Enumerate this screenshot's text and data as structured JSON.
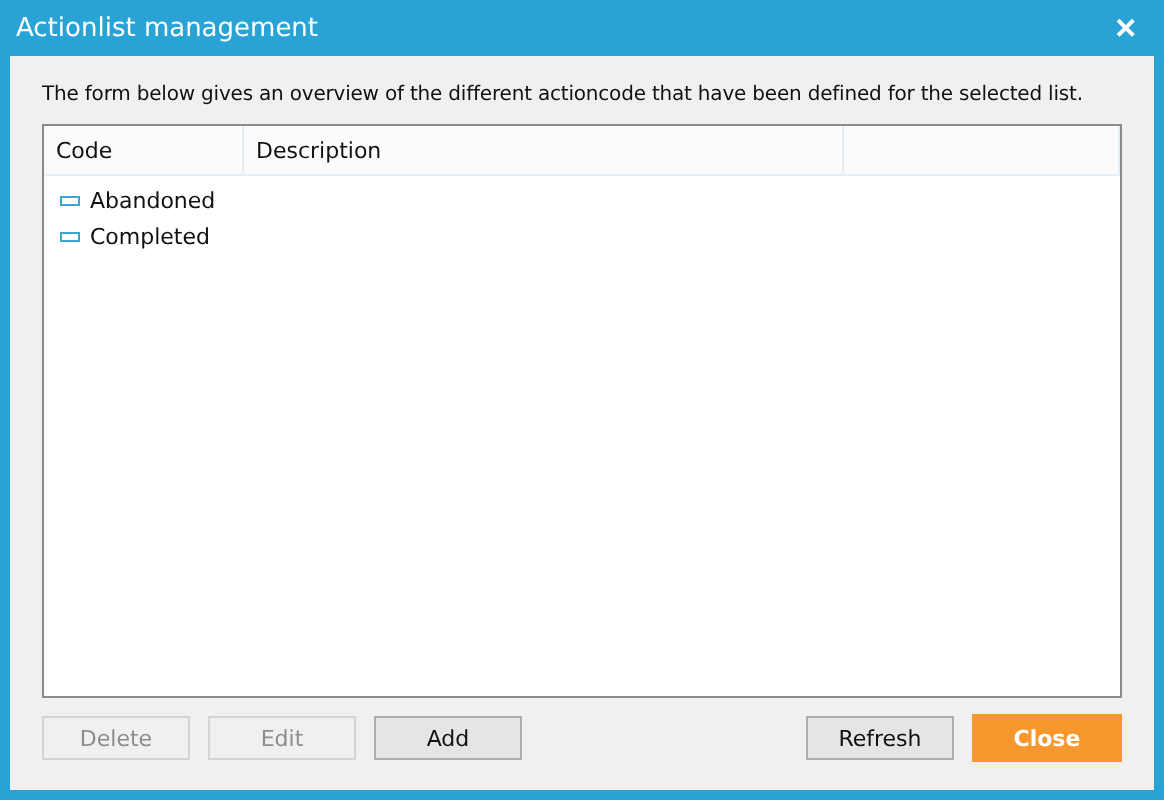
{
  "window": {
    "title": "Actionlist management",
    "close": "✕"
  },
  "intro": "The form below gives an overview of the different actioncode that have been defined for the selected list.",
  "table": {
    "columns": [
      "Code",
      "Description"
    ],
    "rows": [
      {
        "code": "Abandoned"
      },
      {
        "code": "Completed"
      }
    ]
  },
  "buttons_left": [
    {
      "label": "Delete",
      "disabled": true
    },
    {
      "label": "Edit",
      "disabled": true
    },
    {
      "label": "Add",
      "disabled": false
    }
  ],
  "buttons_right": [
    {
      "label": "Refresh",
      "kind": "normal"
    },
    {
      "label": "Close",
      "kind": "primary"
    }
  ]
}
